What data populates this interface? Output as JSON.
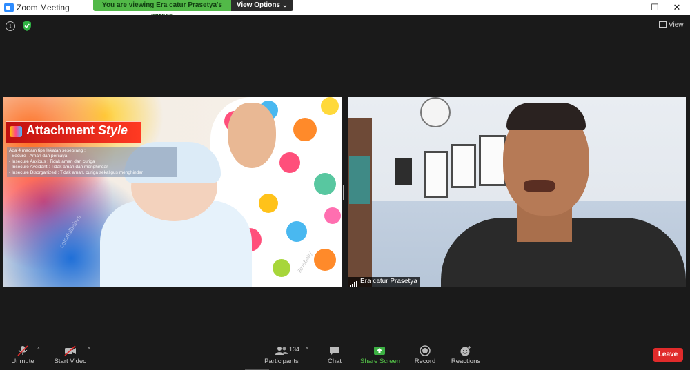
{
  "window": {
    "title": "Zoom Meeting",
    "minimize": "—",
    "maximize": "☐",
    "close": "✕"
  },
  "share_banner": {
    "text": "You are viewing Era catur Prasetya's screen",
    "view_options": "View Options ⌄"
  },
  "top_right": {
    "view_label": "View"
  },
  "slide": {
    "title_main": "Attachment",
    "title_italic": "Style",
    "lines": [
      "Ada 4 macam tipe lekatan seseorang :",
      "-   Secure  : Aman dan percaya",
      "-   Insecure  Anxious : Tidak aman dan curiga",
      "-   Insecure Avoidant : Tidak aman dan menghindar",
      "-   Insecure Disorganized : Tidak aman, curiga sekaligus menghindar"
    ],
    "watermark": "colorfulbabys",
    "watermark2": "ilovebaby"
  },
  "participant": {
    "name": "Era catur Prasetya"
  },
  "toolbar": {
    "unmute": "Unmute",
    "start_video": "Start Video",
    "participants": "Participants",
    "participants_count": "134",
    "chat": "Chat",
    "share_screen": "Share Screen",
    "record": "Record",
    "reactions": "Reactions",
    "leave": "Leave"
  },
  "colors": {
    "share_green": "#52b948",
    "leave_red": "#e02b2b",
    "toolbar_bg": "#1a1a1a"
  },
  "icons": {
    "unmute": "muted-microphone-icon",
    "start_video": "video-off-icon",
    "participants": "people-icon",
    "chat": "speech-bubble-icon",
    "share_screen": "upload-arrow-icon",
    "record": "record-circle-icon",
    "reactions": "smiley-plus-icon",
    "info": "info-icon",
    "encryption": "shield-check-icon"
  }
}
